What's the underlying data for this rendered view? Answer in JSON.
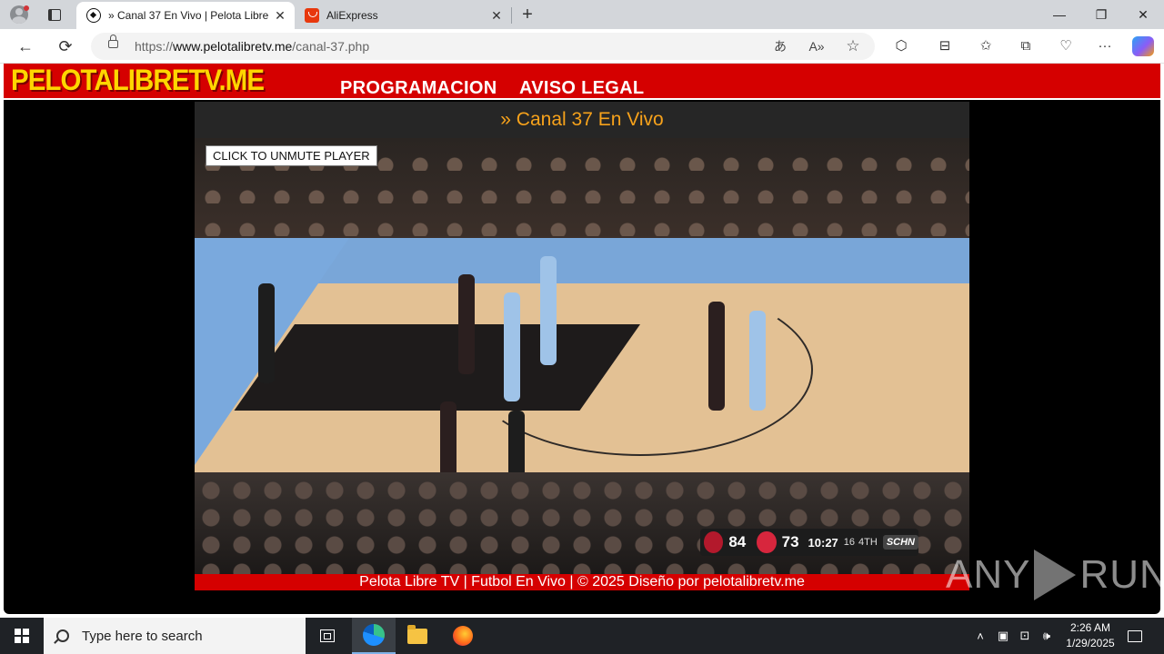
{
  "browser": {
    "tabs": [
      {
        "title": "» Canal 37 En Vivo | Pelota Libre T",
        "active": true,
        "favicon": "soccer-ball-icon"
      },
      {
        "title": "AliExpress",
        "active": false,
        "favicon": "aliexpress-icon"
      }
    ],
    "new_tab": "+",
    "close_glyph": "✕",
    "window_controls": {
      "minimize": "—",
      "restore": "❐",
      "close": "✕"
    },
    "url_prefix": "https://",
    "url_host": "www.pelotalibretv.me",
    "url_path": "/canal-37.php",
    "icons": {
      "back": "←",
      "refresh": "⟳",
      "translate": "あ",
      "read_aloud": "A»",
      "favorite": "☆",
      "extensions": "⬡",
      "split": "⊟",
      "favorites_bar": "✩",
      "collections": "⧉",
      "performance": "♡",
      "more": "···"
    }
  },
  "site": {
    "logo": "PELOTALIBRETV.ME",
    "nav": [
      "PROGRAMACION",
      "AVISO LEGAL"
    ],
    "page_title": "» Canal 37 En Vivo",
    "player": {
      "unmute_label": "CLICK TO UNMUTE PLAYER",
      "score": {
        "home": "84",
        "away": "73",
        "clock": "10:27",
        "shot": "16",
        "quarter": "4TH",
        "network": "SCHN"
      }
    },
    "footer": "Pelota Libre TV | Futbol En Vivo | © 2025 Diseño por pelotalibretv.me",
    "watermark_left": "ANY",
    "watermark_right": "RUN"
  },
  "taskbar": {
    "search_placeholder": "Type here to search",
    "time": "2:26 AM",
    "date": "1/29/2025",
    "tray_icons": [
      "chevron-up",
      "meet-now",
      "network",
      "volume"
    ]
  },
  "colors": {
    "site_red": "#d50000",
    "logo_yellow": "#ffd600",
    "title_orange": "#f7a21b"
  }
}
